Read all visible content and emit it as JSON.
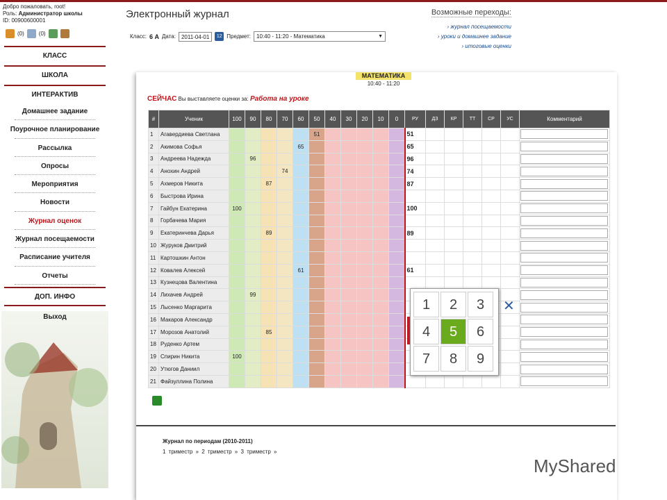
{
  "user": {
    "welcome": "Добро пожаловать, root!",
    "role_label": "Роль:",
    "role": "Администратор школы",
    "id": "ID: 00900600001"
  },
  "icons": [
    {
      "name": "alert-icon",
      "count": "(0)"
    },
    {
      "name": "mail-icon",
      "count": "(0)"
    },
    {
      "name": "users-icon"
    },
    {
      "name": "case-icon"
    }
  ],
  "menu": {
    "headers": [
      "КЛАСС",
      "ШКОЛА",
      "ИНТЕРАКТИВ"
    ],
    "items": [
      "Домашнее задание",
      "Поурочное планирование",
      "Рассылка",
      "Опросы",
      "Мероприятия",
      "Новости",
      "Журнал оценок",
      "Журнал посещаемости",
      "Расписание учителя",
      "Отчеты"
    ],
    "active": "Журнал оценок",
    "extra": "ДОП. ИНФО",
    "exit": "Выход"
  },
  "title": "Электронный журнал",
  "filters": {
    "class_label": "Класс:",
    "class_value": "6 А",
    "date_label": "Дата:",
    "date_value": "2011-04-01",
    "cal_label": "12",
    "subject_label": "Предмет:",
    "subject_value": "10:40 - 11:20 - Математика"
  },
  "transitions": {
    "header": "Возможные переходы:",
    "links": [
      "› журнал посещаемости",
      "› уроки и домашнее задание",
      "› итоговые оценки"
    ]
  },
  "subject": {
    "name": "МАТЕМАТИКА",
    "time": "10:40 - 11:20"
  },
  "now": {
    "label": "СЕЙЧАС",
    "text": "Вы выставляете оценки за:",
    "value": "Работа на уроке"
  },
  "grid": {
    "head_num": "#",
    "head_name": "Ученик",
    "scale": [
      "100",
      "90",
      "80",
      "70",
      "60",
      "50",
      "40",
      "30",
      "20",
      "10",
      "0"
    ],
    "cols": [
      "РУ",
      "ДЗ",
      "КР",
      "ТТ",
      "СР",
      "УС"
    ],
    "comment": "Комментарий",
    "rows": [
      {
        "n": "1",
        "name": "Агавердиева Светлана",
        "score": "51",
        "ru": "51"
      },
      {
        "n": "2",
        "name": "Акимова Софья",
        "score": "65",
        "ru": "65"
      },
      {
        "n": "3",
        "name": "Андреева Надежда",
        "score": "96",
        "ru": "96"
      },
      {
        "n": "4",
        "name": "Анохин Андрей",
        "score": "74",
        "ru": "74"
      },
      {
        "n": "5",
        "name": "Ахмеров Никита",
        "score": "87",
        "ru": "87"
      },
      {
        "n": "6",
        "name": "Быстрова Ирина",
        "score": "",
        "ru": ""
      },
      {
        "n": "7",
        "name": "Гайбун Екатерина",
        "score": "100",
        "ru": "100"
      },
      {
        "n": "8",
        "name": "Горбачева Мария",
        "score": "",
        "ru": ""
      },
      {
        "n": "9",
        "name": "Екатеринчева Дарья",
        "score": "89",
        "ru": "89"
      },
      {
        "n": "10",
        "name": "Журуков Дмитрий",
        "score": "",
        "ru": ""
      },
      {
        "n": "11",
        "name": "Картошкин Антон",
        "score": "",
        "ru": ""
      },
      {
        "n": "12",
        "name": "Ковалев Алексей",
        "score": "61",
        "ru": "61"
      },
      {
        "n": "13",
        "name": "Кузнецова Валентина",
        "score": "",
        "ru": ""
      },
      {
        "n": "14",
        "name": "Лихачев Андрей",
        "score": "99",
        "ru": ""
      },
      {
        "n": "15",
        "name": "Лысенко Маргарита",
        "score": "",
        "ru": ""
      },
      {
        "n": "16",
        "name": "Макаров Александр",
        "score": "",
        "ru": ""
      },
      {
        "n": "17",
        "name": "Морозов Анатолий",
        "score": "85",
        "ru": ""
      },
      {
        "n": "18",
        "name": "Руденко Артем",
        "score": "",
        "ru": ""
      },
      {
        "n": "19",
        "name": "Спирин Никита",
        "score": "100",
        "ru": ""
      },
      {
        "n": "20",
        "name": "Утюгов Даниил",
        "score": "",
        "ru": ""
      },
      {
        "n": "21",
        "name": "Файзуллина Полина",
        "score": "",
        "ru": ""
      }
    ]
  },
  "keypad": {
    "keys": [
      "1",
      "2",
      "3",
      "4",
      "5",
      "6",
      "7",
      "8",
      "9"
    ],
    "selected": "5",
    "close": "✕"
  },
  "periods": {
    "title": "Журнал по периодам (2010-2011)",
    "links": [
      "1 триместр »",
      "2 триместр »",
      "3 триместр »"
    ]
  },
  "watermark": "MyShared"
}
